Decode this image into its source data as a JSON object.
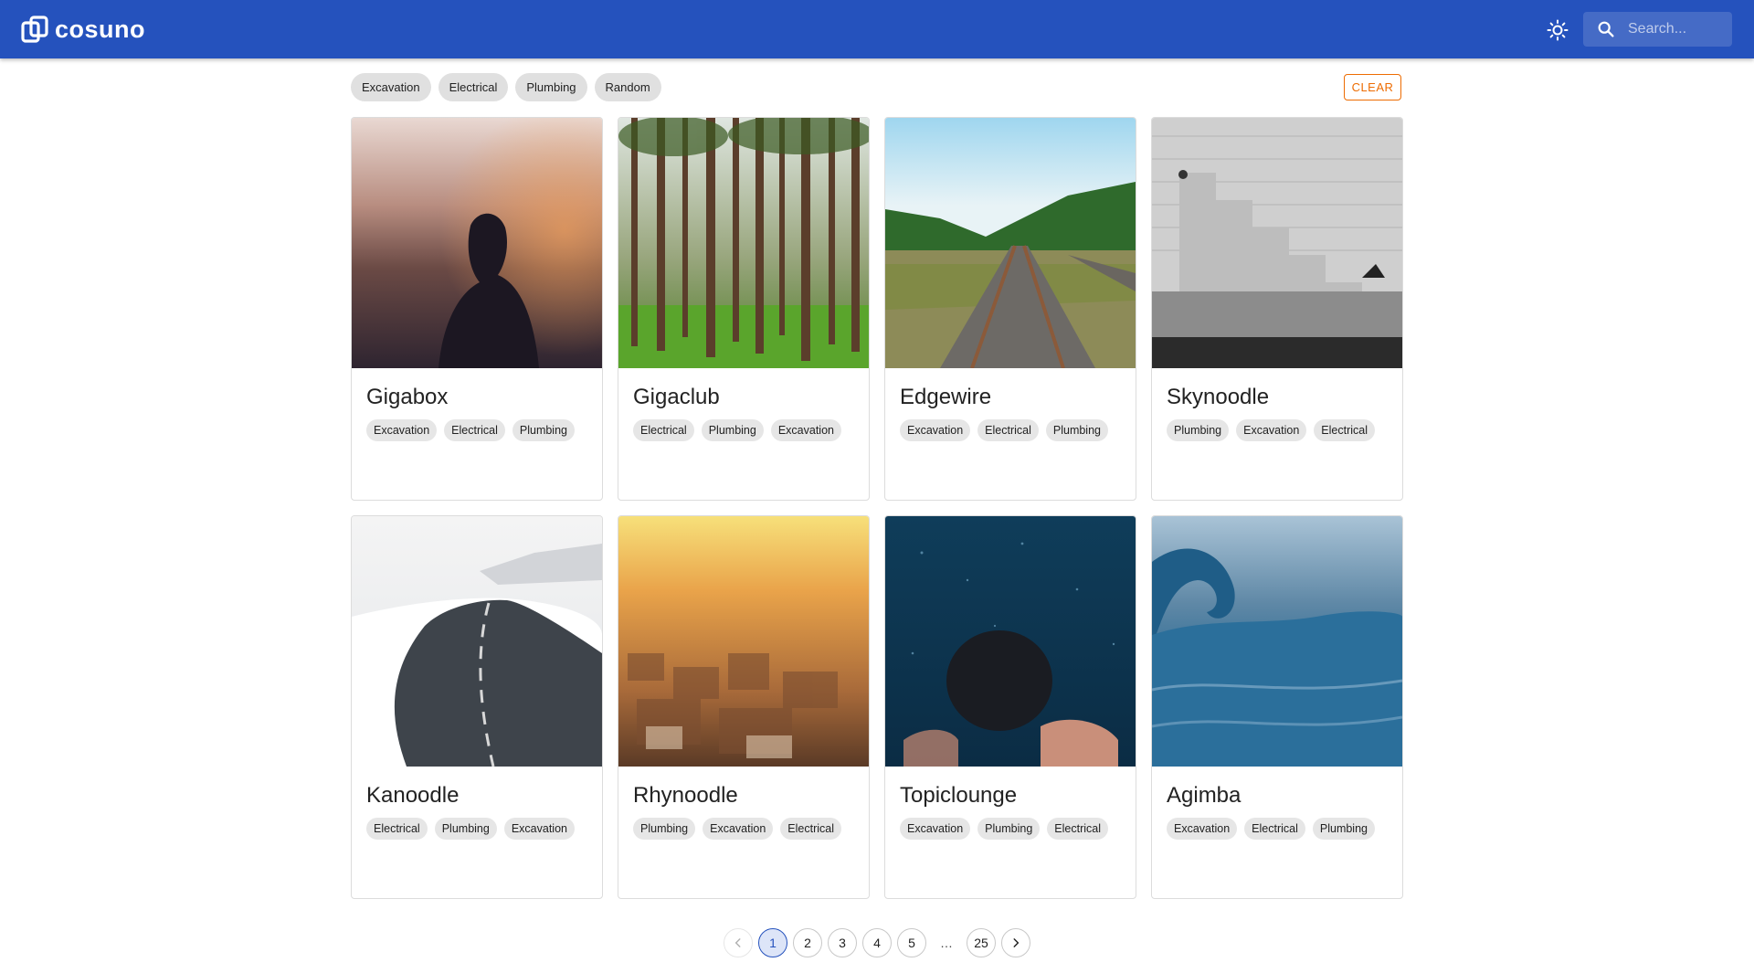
{
  "app": {
    "logo_text": "cosuno",
    "search": {
      "placeholder": "Search..."
    }
  },
  "filters": {
    "chips": [
      "Excavation",
      "Electrical",
      "Plumbing",
      "Random"
    ],
    "clear_label": "CLEAR"
  },
  "cards": [
    {
      "title": "Gigabox",
      "tags": [
        "Excavation",
        "Electrical",
        "Plumbing"
      ]
    },
    {
      "title": "Gigaclub",
      "tags": [
        "Electrical",
        "Plumbing",
        "Excavation"
      ]
    },
    {
      "title": "Edgewire",
      "tags": [
        "Excavation",
        "Electrical",
        "Plumbing"
      ]
    },
    {
      "title": "Skynoodle",
      "tags": [
        "Plumbing",
        "Excavation",
        "Electrical"
      ]
    },
    {
      "title": "Kanoodle",
      "tags": [
        "Electrical",
        "Plumbing",
        "Excavation"
      ]
    },
    {
      "title": "Rhynoodle",
      "tags": [
        "Plumbing",
        "Excavation",
        "Electrical"
      ]
    },
    {
      "title": "Topiclounge",
      "tags": [
        "Excavation",
        "Plumbing",
        "Electrical"
      ]
    },
    {
      "title": "Agimba",
      "tags": [
        "Excavation",
        "Electrical",
        "Plumbing"
      ]
    }
  ],
  "pagination": {
    "pages": [
      "1",
      "2",
      "3",
      "4",
      "5"
    ],
    "ellipsis": "…",
    "last": "25",
    "current": "1"
  },
  "colors": {
    "appbar": "#2552bd",
    "clear_accent": "#ed6c02"
  }
}
